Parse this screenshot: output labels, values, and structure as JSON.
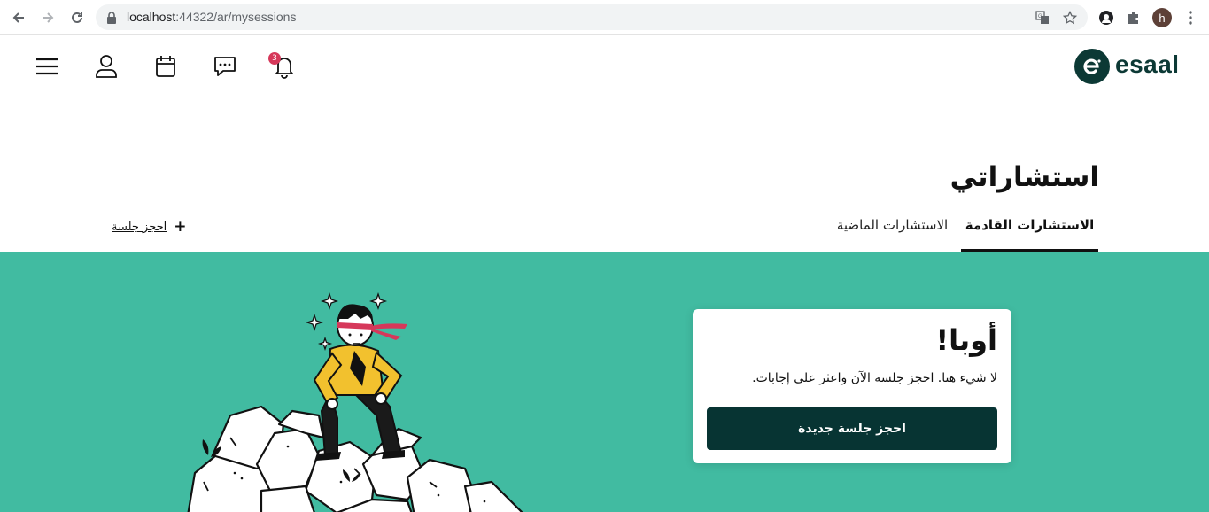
{
  "browser": {
    "url_host": "localhost",
    "url_port": ":44322",
    "url_path": "/ar/mysessions",
    "profile_initial": "h"
  },
  "header": {
    "notification_count": "3",
    "logo_text": "esaal",
    "brand_color": "#0c3935"
  },
  "page": {
    "title": "استشاراتي",
    "tabs": [
      {
        "label": "الاستشارات القادمة",
        "active": true
      },
      {
        "label": "الاستشارات الماضية",
        "active": false
      }
    ],
    "book_link": "احجز جلسة"
  },
  "empty_state": {
    "title": "أوبا!",
    "message": "لا شيء هنا. احجز جلسة الآن واعثر على إجابات.",
    "cta": "احجز جلسة جديدة",
    "accent_color": "#41bba1",
    "button_color": "#073433"
  }
}
